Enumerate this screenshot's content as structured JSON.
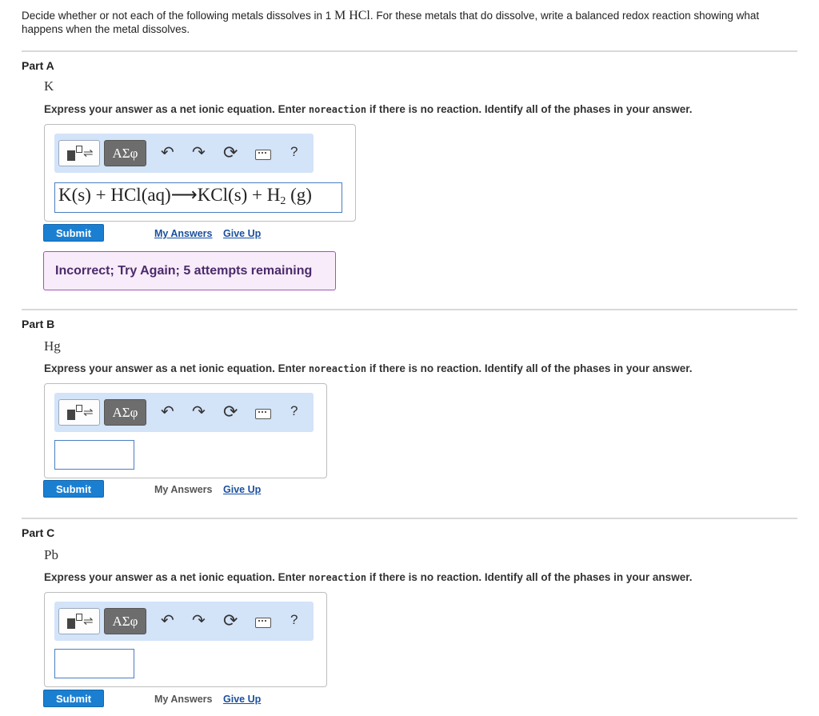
{
  "intro": {
    "before": "Decide whether or not each of the following metals dissolves in 1 ",
    "math": "M HCl",
    "after": ". For these metals that do dissolve, write a balanced redox reaction showing what happens when the metal dissolves."
  },
  "instruction": {
    "before": "Express your answer as a net ionic equation. Enter ",
    "code": "noreaction",
    "after": " if there is no reaction. Identify all of the phases in your answer."
  },
  "toolbar": {
    "greek_label": "ΑΣφ",
    "undo_glyph": "↶",
    "redo_glyph": "↷",
    "reset_glyph": "⟳",
    "help_label": "?"
  },
  "buttons": {
    "submit": "Submit",
    "my_answers": "My Answers",
    "give_up": "Give Up"
  },
  "parts": [
    {
      "title": "Part A",
      "metal": "K",
      "answer": {
        "pre": "K(s) + HCl(aq)⟶KCl(s) + H",
        "sub": "2",
        "post": " (g)"
      },
      "feedback": "Incorrect; Try Again; 5 attempts remaining"
    },
    {
      "title": "Part B",
      "metal": "Hg",
      "answer": ""
    },
    {
      "title": "Part C",
      "metal": "Pb",
      "answer": ""
    }
  ],
  "colors": {
    "submit_bg": "#1b7fd1",
    "link": "#1a4f9e",
    "toolbar_bg": "#d3e3f8",
    "feedback_border": "#a154b7",
    "feedback_bg": "#f8ecfa"
  }
}
